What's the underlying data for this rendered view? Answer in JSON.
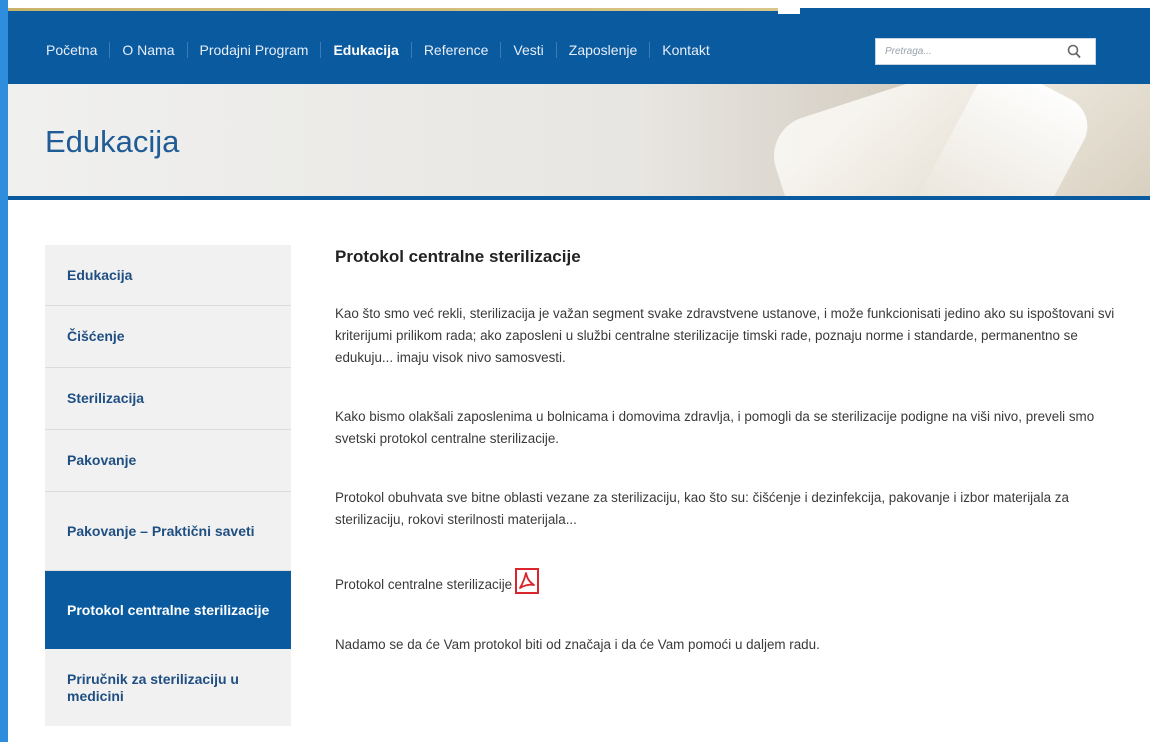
{
  "nav": {
    "items": [
      "Početna",
      "O Nama",
      "Prodajni Program",
      "Edukacija",
      "Reference",
      "Vesti",
      "Zaposlenje",
      "Kontakt"
    ],
    "active_index": 3
  },
  "search": {
    "placeholder": "Pretraga..."
  },
  "banner": {
    "title": "Edukacija"
  },
  "sidebar": {
    "items": [
      {
        "label": "Edukacija"
      },
      {
        "label": "Čišćenje"
      },
      {
        "label": "Sterilizacija"
      },
      {
        "label": "Pakovanje"
      },
      {
        "label": "Pakovanje – Praktični saveti"
      },
      {
        "label": "Protokol centralne sterilizacije"
      },
      {
        "label": "Priručnik za sterilizaciju u medicini"
      }
    ],
    "active_index": 5
  },
  "content": {
    "title": "Protokol centralne sterilizacije",
    "p1": "Kao što smo već rekli, sterilizacija je važan segment svake zdravstvene ustanove, i može funkcionisati jedino ako su ispoštovani svi kriterijumi prilikom rada; ako zaposleni u službi centralne sterilizacije timski rade, poznaju norme i standarde, permanentno se edukuju... imaju visok nivo samosvesti.",
    "p2": "Kako bismo olakšali zaposlenima u bolnicama i domovima zdravlja, i pomogli da se sterilizacije podigne na viši nivo, preveli smo svetski protokol centralne sterilizacije.",
    "p3": "Protokol obuhvata sve bitne oblasti vezane za sterilizaciju, kao što su: čišćenje i dezinfekcija, pakovanje i izbor materijala za sterilizaciju, rokovi sterilnosti materijala...",
    "pdf_link": "Protokol centralne sterilizacije",
    "p4": "Nadamo se da će Vam protokol biti od značaja i da će Vam pomoći u daljem radu."
  },
  "colors": {
    "nav_bg": "#0a5aa0",
    "title_blue": "#1f5c96",
    "sidebar_text": "#1f4f82",
    "pdf_red": "#d9262c",
    "frame_blue": "#2e8ddc"
  }
}
